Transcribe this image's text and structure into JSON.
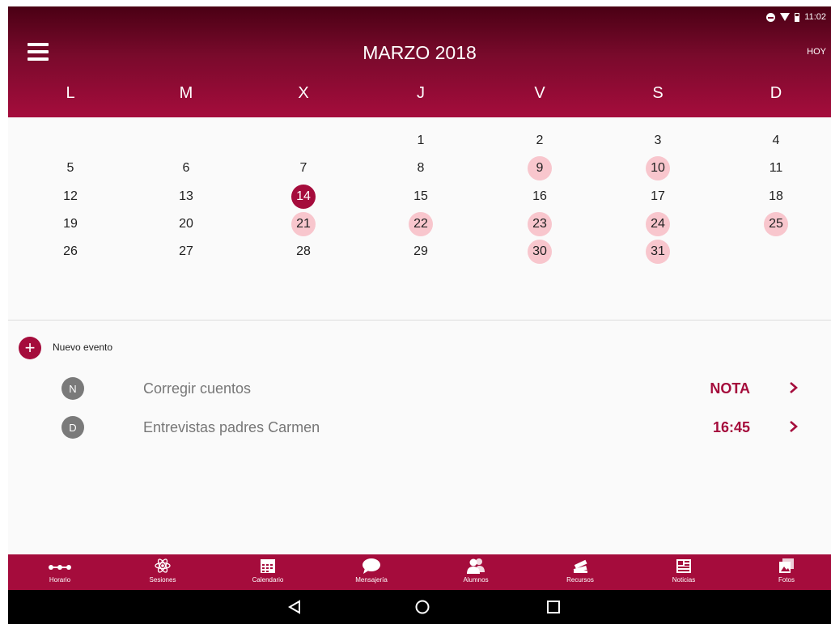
{
  "status_bar": {
    "time": "11:02"
  },
  "header": {
    "month": "MARZO 2018",
    "today_label": "HOY"
  },
  "weekdays": [
    "L",
    "M",
    "X",
    "J",
    "V",
    "S",
    "D"
  ],
  "calendar": {
    "weeks": [
      [
        null,
        null,
        null,
        "1",
        "2",
        "3",
        "4"
      ],
      [
        "5",
        "6",
        "7",
        "8",
        "9",
        "10",
        "11"
      ],
      [
        "12",
        "13",
        "14",
        "15",
        "16",
        "17",
        "18"
      ],
      [
        "19",
        "20",
        "21",
        "22",
        "23",
        "24",
        "25"
      ],
      [
        "26",
        "27",
        "28",
        "29",
        "30",
        "31",
        null
      ]
    ],
    "today": "14",
    "highlighted": [
      "9",
      "10",
      "21",
      "22",
      "23",
      "24",
      "25",
      "30",
      "31"
    ]
  },
  "colors": {
    "accent": "#a50c3c",
    "highlight": "#f8c6cd",
    "header_dark": "#4a0014"
  },
  "new_event": {
    "label": "Nuevo evento",
    "icon": "plus-icon"
  },
  "events": [
    {
      "initial": "N",
      "title": "Corregir cuentos",
      "tag": "NOTA"
    },
    {
      "initial": "D",
      "title": "Entrevistas padres Carmen",
      "tag": "16:45"
    }
  ],
  "bottom_nav": [
    {
      "label": "Horario",
      "icon": "timeline-icon"
    },
    {
      "label": "Sesiones",
      "icon": "atom-icon"
    },
    {
      "label": "Calendario",
      "icon": "calendar-icon"
    },
    {
      "label": "Mensajería",
      "icon": "chat-bubble-icon"
    },
    {
      "label": "Alumnos",
      "icon": "people-icon"
    },
    {
      "label": "Recursos",
      "icon": "books-icon"
    },
    {
      "label": "Noticias",
      "icon": "newspaper-icon"
    },
    {
      "label": "Fotos",
      "icon": "photos-icon"
    }
  ],
  "system_nav": [
    "back-icon",
    "home-icon",
    "recents-icon"
  ]
}
